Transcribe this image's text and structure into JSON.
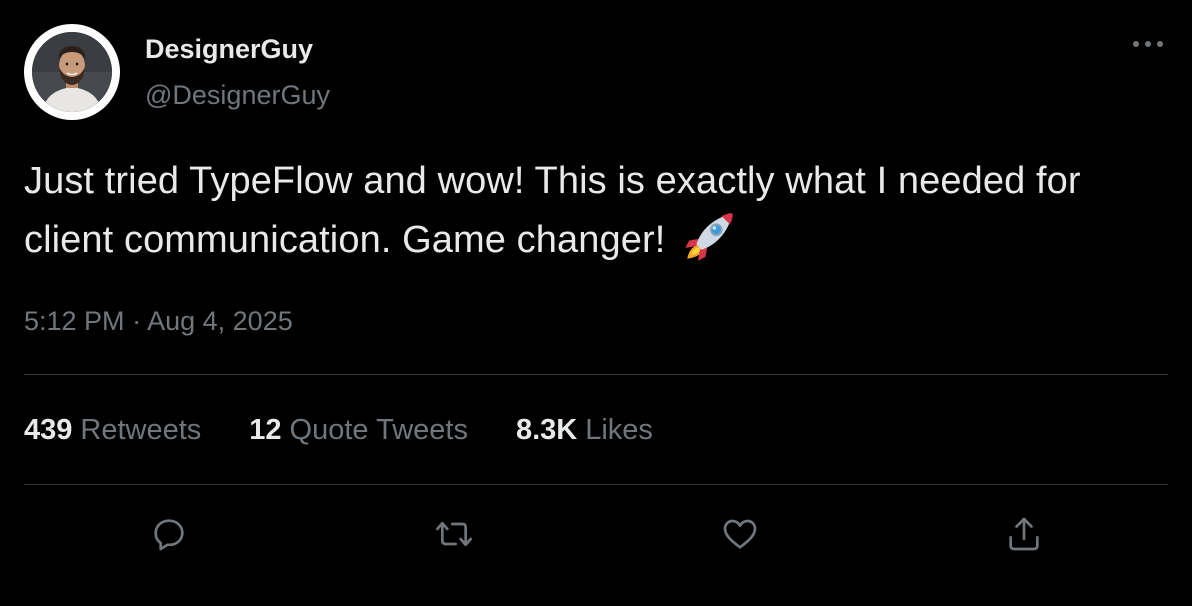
{
  "author": {
    "display_name": "DesignerGuy",
    "handle": "@DesignerGuy",
    "avatar_icon": "person-avatar"
  },
  "tweet": {
    "text": "Just tried TypeFlow and wow! This is exactly what I needed for client communication. Game changer!",
    "emoji_icon": "rocket-emoji",
    "time": "5:12 PM",
    "separator": "·",
    "date": "Aug 4, 2025"
  },
  "stats": {
    "retweets_count": "439",
    "retweets_label": "Retweets",
    "quotes_count": "12",
    "quotes_label": "Quote Tweets",
    "likes_count": "8.3K",
    "likes_label": "Likes"
  },
  "actions": {
    "reply_icon": "reply-icon",
    "retweet_icon": "retweet-icon",
    "like_icon": "heart-icon",
    "share_icon": "share-icon",
    "more_icon": "more-options-icon"
  },
  "colors": {
    "background": "#000000",
    "primary_text": "#e7e9ea",
    "secondary_text": "#71767b",
    "divider": "#2f3336"
  }
}
